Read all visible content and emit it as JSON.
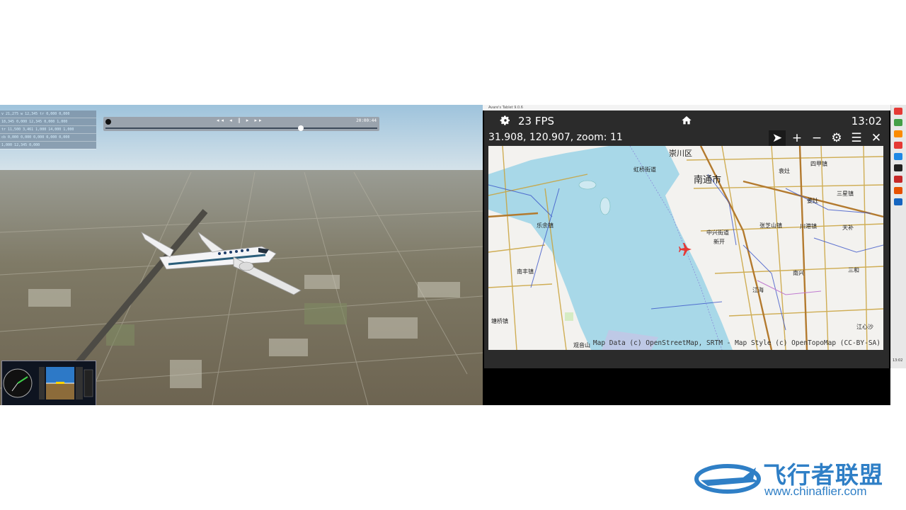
{
  "sim": {
    "replay_time": "20:00:44",
    "replay_controls": "◂◂ ◂ ‖ ▸ ▸▸",
    "replay_position": 0.72,
    "data_rows": [
      "v 21,275  w 12,345  tr 0,000  0,000",
      "18,345  0,000  12,345  0,000  1,000",
      "tr 11,500  3,461  1,000  14,000  1,000",
      "cb 0,000  0,000  0,000  0,000  0,000",
      "1,000  12,345  0,000"
    ]
  },
  "avare": {
    "window_title": "Avare's Tablet 9.0.6",
    "fps": "23 FPS",
    "clock": "13:02",
    "coords": "31.908, 120.907, zoom: 11",
    "toolbar_icons": [
      "navigate-icon",
      "zoom-in-icon",
      "zoom-out-icon",
      "settings-icon",
      "list-icon",
      "close-icon"
    ],
    "toolbar_glyphs": [
      "➤",
      "+",
      "−",
      "⚙",
      "☰",
      "✕"
    ],
    "map_labels": {
      "city1": "崇川区",
      "city2": "南通市",
      "l1": "乐余镇",
      "l2": "南丰镇",
      "l3": "塘桥镇",
      "l4": "虹桥街道",
      "l5": "中兴街道",
      "l6": "张芝山镇",
      "l7": "川港镇",
      "l8": "新开",
      "l9": "江海",
      "l10": "江心沙",
      "l11": "三星镇",
      "l12": "天补",
      "l13": "南兴",
      "l14": "三和",
      "l15": "四甲镇",
      "l16": "袁灶",
      "l17": "姜灶",
      "l18": "观音山"
    },
    "attribution": "Map Data (c) OpenStreetMap, SRTM - Map Style (c) OpenTopoMap (CC-BY-SA)"
  },
  "taskbar": {
    "clock": "13:02",
    "icon_colors": [
      "#e53935",
      "#43a047",
      "#fb8c00",
      "#e53935",
      "#1e88e5",
      "#212121",
      "#c62828",
      "#e65100",
      "#1565c0"
    ]
  },
  "watermark": {
    "title": "飞行者联盟",
    "url": "www.chinaflier.com"
  }
}
